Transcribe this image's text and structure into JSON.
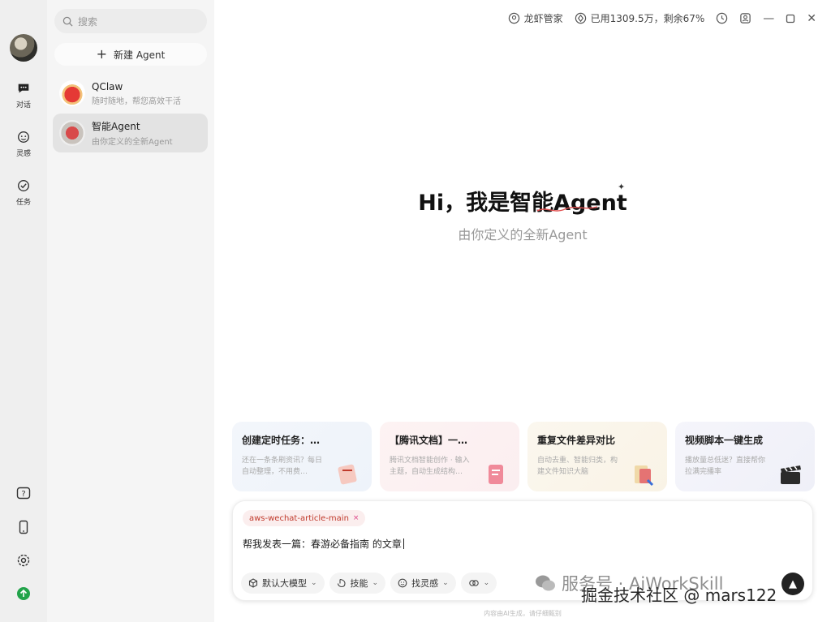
{
  "rail": {
    "items": [
      {
        "label": "对话",
        "icon": "chat-icon"
      },
      {
        "label": "灵感",
        "icon": "inspiration-icon"
      },
      {
        "label": "任务",
        "icon": "task-icon"
      }
    ],
    "bottom_icons": [
      "help-icon",
      "phone-icon",
      "settings-icon",
      "upgrade-icon"
    ]
  },
  "sidebar": {
    "search_placeholder": "搜索",
    "new_agent_label": "新建 Agent",
    "agents": [
      {
        "name": "QClaw",
        "desc": "随时随地，帮您高效干活"
      },
      {
        "name": "智能Agent",
        "desc": "由你定义的全新Agent"
      }
    ]
  },
  "topbar": {
    "manager_label": "龙虾管家",
    "usage_label": "已用1309.5万，剩余67%"
  },
  "hero": {
    "title": "Hi，我是智能Agent",
    "subtitle": "由你定义的全新Agent"
  },
  "cards": [
    {
      "title": "创建定时任务：…",
      "desc": "还在一条条刷资讯？每日自动整理，不用费…"
    },
    {
      "title": "【腾讯文档】一…",
      "desc": "腾讯文档智能创作 · 输入主题，自动生成结构…"
    },
    {
      "title": "重复文件差异对比",
      "desc": "自动去重、智能归类，构建文件知识大脑"
    },
    {
      "title": "视频脚本一键生成",
      "desc": "播放量总低迷？直接帮你拉满完播率"
    }
  ],
  "composer": {
    "tag": "aws-wechat-article-main",
    "text": "帮我发表一篇：春游必备指南  的文章",
    "chips": [
      "默认大模型",
      "技能",
      "找灵感",
      ""
    ]
  },
  "footnote": "内容由AI生成，请仔细甄别",
  "watermark": {
    "line1": "服务号 · AiWorkSkill",
    "line2": "掘金技术社区 @ mars122"
  },
  "colors": {
    "accent_green": "#22a34a",
    "tag_red": "#c0392b"
  }
}
